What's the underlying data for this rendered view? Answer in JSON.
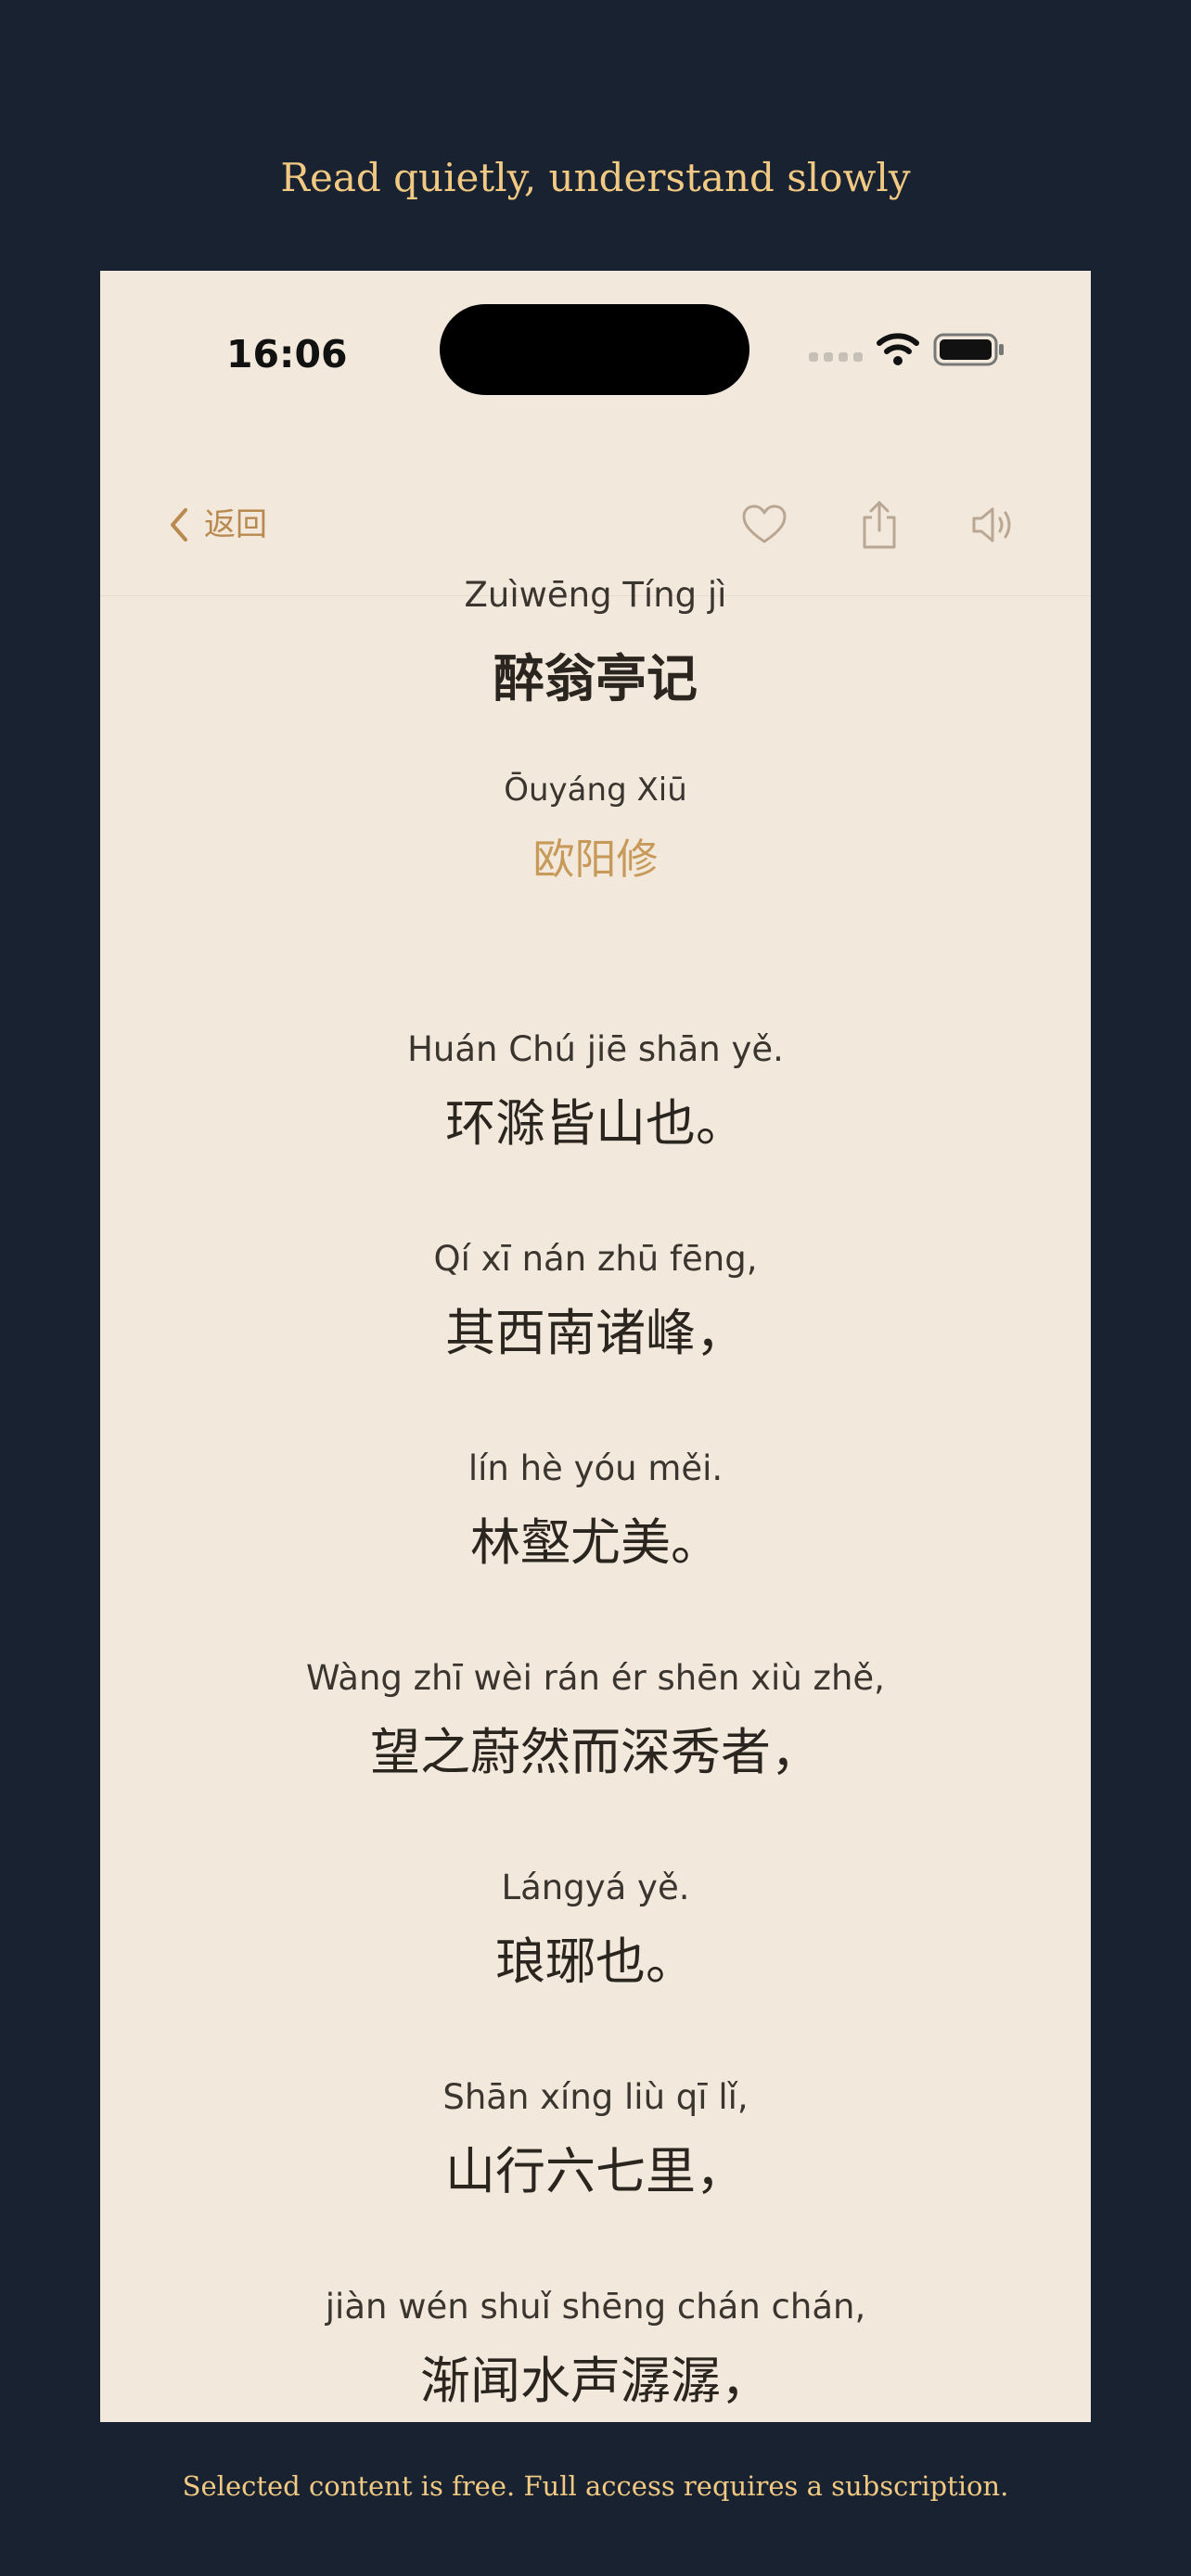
{
  "tagline": "Read quietly, understand slowly",
  "footer_note": "Selected content is free. Full access requires a subscription.",
  "status_bar": {
    "time": "16:06",
    "icons": [
      "cellular-signal-icon",
      "wifi-icon",
      "battery-icon"
    ]
  },
  "navbar": {
    "back_label": "返回",
    "icons": [
      "heart-icon",
      "share-icon",
      "speaker-icon"
    ]
  },
  "poem": {
    "title_pinyin": "Zuìwēng Tíng jì",
    "title": "醉翁亭记",
    "author_pinyin": "Ōuyáng Xiū",
    "author": "欧阳修",
    "lines": [
      {
        "pinyin": "Huán Chú jiē shān yě.",
        "hanzi": "环滁皆山也。"
      },
      {
        "pinyin": "Qí xī nán zhū fēng,",
        "hanzi": "其西南诸峰，"
      },
      {
        "pinyin": "lín hè yóu měi.",
        "hanzi": "林壑尤美。"
      },
      {
        "pinyin": "Wàng zhī wèi rán ér shēn xiù zhě,",
        "hanzi": "望之蔚然而深秀者，"
      },
      {
        "pinyin": "Lángyá yě.",
        "hanzi": "琅琊也。"
      },
      {
        "pinyin": "Shān xíng liù qī lǐ,",
        "hanzi": "山行六七里，"
      },
      {
        "pinyin": "jiàn wén shuǐ shēng chán chán,",
        "hanzi": "渐闻水声潺潺，"
      }
    ]
  },
  "colors": {
    "background": "#182231",
    "page": "#f2e9dc",
    "accent": "#b98a4f",
    "tagline": "#f1c983"
  }
}
